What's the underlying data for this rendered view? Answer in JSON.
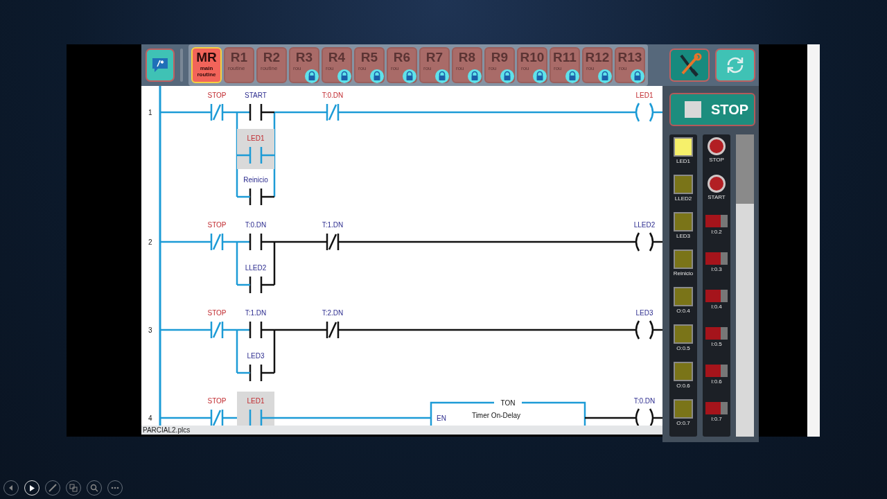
{
  "routines": [
    {
      "code": "MR",
      "caption": "main\nroutine",
      "selected": true,
      "locked": false
    },
    {
      "code": "R1",
      "caption": "routine",
      "selected": false,
      "locked": false
    },
    {
      "code": "R2",
      "caption": "routine",
      "selected": false,
      "locked": false
    },
    {
      "code": "R3",
      "caption": "rou",
      "selected": false,
      "locked": true
    },
    {
      "code": "R4",
      "caption": "rou",
      "selected": false,
      "locked": true
    },
    {
      "code": "R5",
      "caption": "rou",
      "selected": false,
      "locked": true
    },
    {
      "code": "R6",
      "caption": "rou",
      "selected": false,
      "locked": true
    },
    {
      "code": "R7",
      "caption": "rou",
      "selected": false,
      "locked": true
    },
    {
      "code": "R8",
      "caption": "rou",
      "selected": false,
      "locked": true
    },
    {
      "code": "R9",
      "caption": "rou",
      "selected": false,
      "locked": true
    },
    {
      "code": "R10",
      "caption": "rou",
      "selected": false,
      "locked": true
    },
    {
      "code": "R11",
      "caption": "rou",
      "selected": false,
      "locked": true
    },
    {
      "code": "R12",
      "caption": "rou",
      "selected": false,
      "locked": true
    },
    {
      "code": "R13",
      "caption": "rou",
      "selected": false,
      "locked": true
    }
  ],
  "run_button": {
    "label": "STOP"
  },
  "rungs": [
    {
      "number": "1",
      "contacts": [
        {
          "kind": "nc",
          "tag": "STOP",
          "conducting": true,
          "highlighted": false
        },
        {
          "kind": "no",
          "tag": "START",
          "conducting": false,
          "highlighted": false,
          "branches": [
            {
              "kind": "no",
              "tag": "LED1",
              "conducting": true,
              "highlighted": true
            },
            {
              "kind": "no",
              "tag": "Reinicio",
              "conducting": false,
              "highlighted": false
            }
          ]
        },
        {
          "kind": "nc",
          "tag": "T:0.DN",
          "conducting": true,
          "highlighted": false
        }
      ],
      "coil": {
        "tag": "LED1",
        "energized": true
      }
    },
    {
      "number": "2",
      "contacts": [
        {
          "kind": "nc",
          "tag": "STOP",
          "conducting": true,
          "highlighted": false
        },
        {
          "kind": "no",
          "tag": "T:0.DN",
          "conducting": false,
          "highlighted": false,
          "branches": [
            {
              "kind": "no",
              "tag": "LLED2",
              "conducting": false,
              "highlighted": false
            }
          ]
        },
        {
          "kind": "nc",
          "tag": "T:1.DN",
          "conducting": false,
          "highlighted": false
        }
      ],
      "coil": {
        "tag": "LLED2",
        "energized": false
      }
    },
    {
      "number": "3",
      "contacts": [
        {
          "kind": "nc",
          "tag": "STOP",
          "conducting": true,
          "highlighted": false
        },
        {
          "kind": "no",
          "tag": "T:1.DN",
          "conducting": false,
          "highlighted": false,
          "branches": [
            {
              "kind": "no",
              "tag": "LED3",
              "conducting": false,
              "highlighted": false
            }
          ]
        },
        {
          "kind": "nc",
          "tag": "T:2.DN",
          "conducting": false,
          "highlighted": false
        }
      ],
      "coil": {
        "tag": "LED3",
        "energized": false
      }
    },
    {
      "number": "4",
      "contacts": [
        {
          "kind": "nc",
          "tag": "STOP",
          "conducting": true,
          "highlighted": false
        },
        {
          "kind": "no",
          "tag": "LED1",
          "conducting": true,
          "highlighted": true
        }
      ],
      "timer": {
        "title": "TON",
        "subtitle": "Timer On-Delay",
        "input": "EN",
        "done": false
      },
      "coil": {
        "tag": "T:0.DN",
        "energized": false
      }
    }
  ],
  "file_name": "PARCIAL2.plcs",
  "outputs": [
    {
      "label": "LED1",
      "on": true
    },
    {
      "label": "LLED2",
      "on": false
    },
    {
      "label": "LED3",
      "on": false
    },
    {
      "label": "Reinicio",
      "on": false
    },
    {
      "label": "O:0.4",
      "on": false
    },
    {
      "label": "O:0.5",
      "on": false
    },
    {
      "label": "O:0.6",
      "on": false
    },
    {
      "label": "O:0.7",
      "on": false
    }
  ],
  "inputs": [
    {
      "label": "STOP",
      "kind": "button"
    },
    {
      "label": "START",
      "kind": "button"
    },
    {
      "label": "I:0.2",
      "kind": "switch",
      "on": false
    },
    {
      "label": "I:0.3",
      "kind": "switch",
      "on": false
    },
    {
      "label": "I:0.4",
      "kind": "switch",
      "on": false
    },
    {
      "label": "I:0.5",
      "kind": "switch",
      "on": false
    },
    {
      "label": "I:0.6",
      "kind": "switch",
      "on": false
    },
    {
      "label": "I:0.7",
      "kind": "switch",
      "on": false
    }
  ]
}
